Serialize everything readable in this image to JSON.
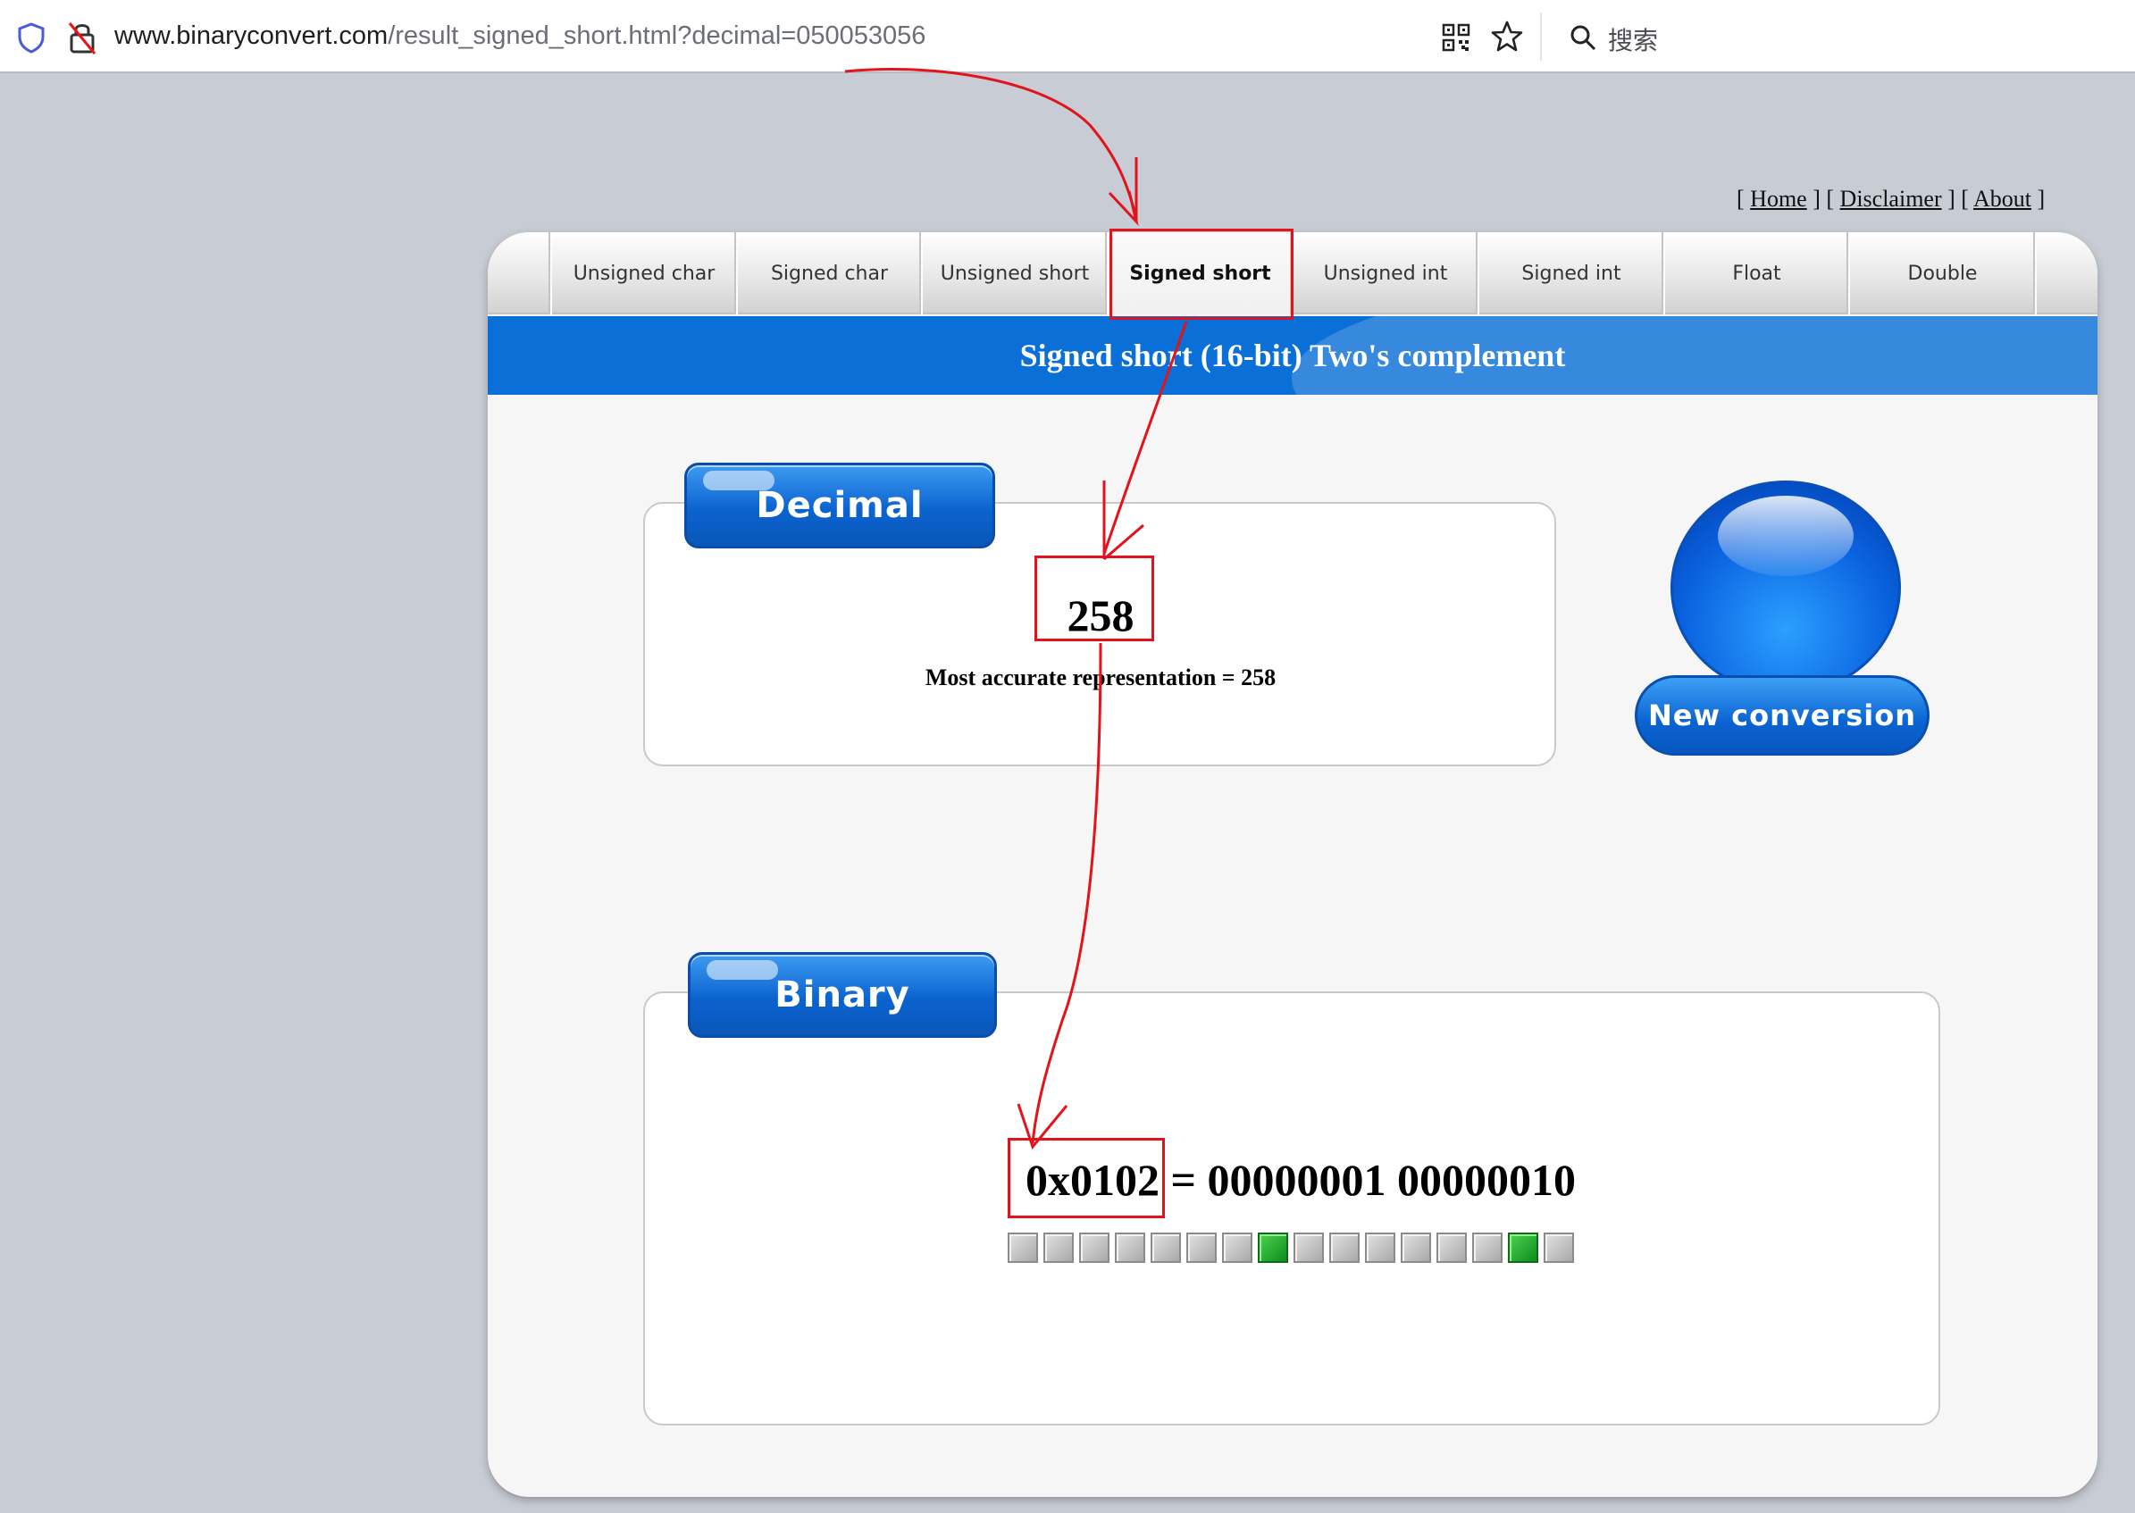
{
  "browser": {
    "url_host": "www.binaryconvert.com",
    "url_rest": "/result_signed_short.html?decimal=050053056",
    "search_label": "搜索"
  },
  "top_links": {
    "home": "Home",
    "disclaimer": "Disclaimer",
    "about": "About"
  },
  "tabs": [
    {
      "label": "Unsigned char",
      "active": false
    },
    {
      "label": "Signed char",
      "active": false
    },
    {
      "label": "Unsigned short",
      "active": false
    },
    {
      "label": "Signed short",
      "active": true
    },
    {
      "label": "Unsigned int",
      "active": false
    },
    {
      "label": "Signed int",
      "active": false
    },
    {
      "label": "Float",
      "active": false
    },
    {
      "label": "Double",
      "active": false
    }
  ],
  "banner_title": "Signed short (16-bit) Two's complement",
  "decimal": {
    "heading": "Decimal",
    "value": "258",
    "note": "Most accurate representation = 258"
  },
  "binary": {
    "heading": "Binary",
    "hex": "0x0102",
    "equals_binary": " = 00000001 00000010",
    "bits": [
      0,
      0,
      0,
      0,
      0,
      0,
      0,
      1,
      0,
      0,
      0,
      0,
      0,
      0,
      1,
      0
    ]
  },
  "new_conversion_label": "New conversion",
  "colors": {
    "accent_blue": "#0a6fd6",
    "bit_on": "#0b8c1e",
    "bit_off": "#a8a8a8",
    "annotation_red": "#e3131b"
  }
}
